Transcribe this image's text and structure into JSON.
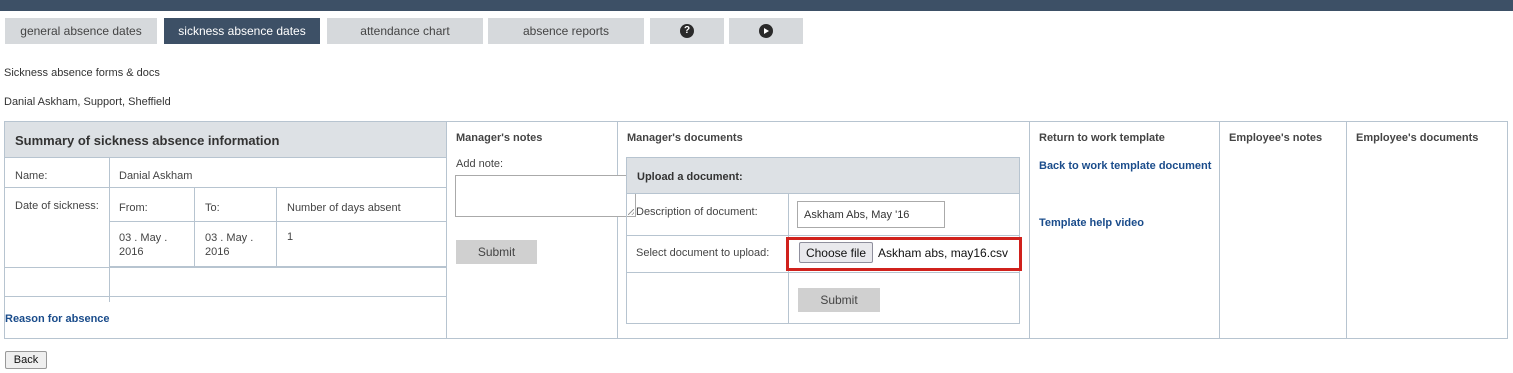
{
  "tabs": [
    {
      "label": "general absence dates",
      "active": false
    },
    {
      "label": "sickness absence dates",
      "active": true
    },
    {
      "label": "attendance chart",
      "active": false
    },
    {
      "label": "absence reports",
      "active": false
    }
  ],
  "tab_icons": [
    "help-icon",
    "play-icon"
  ],
  "subtitle": "Sickness absence forms & docs",
  "employee_line": "Danial Askham, Support, Sheffield",
  "summary": {
    "heading": "Summary of sickness absence information",
    "name_label": "Name:",
    "name_value": "Danial Askham",
    "date_label": "Date of sickness:",
    "from_label": "From:",
    "to_label": "To:",
    "days_label": "Number of days absent",
    "from_value": "03 . May . 2016",
    "to_value": "03 . May . 2016",
    "days_value": "1",
    "reason_link": "Reason for absence"
  },
  "managers_notes": {
    "heading": "Manager's notes",
    "add_note_label": "Add note:",
    "note_value": "",
    "submit_label": "Submit"
  },
  "managers_documents": {
    "heading": "Manager's documents",
    "upload_heading": "Upload a document:",
    "description_label": "Description of document:",
    "description_value": "Askham Abs, May '16",
    "select_label": "Select document to upload:",
    "choose_file_label": "Choose file",
    "file_name": "Askham abs, may16.csv",
    "submit_label": "Submit"
  },
  "return_to_work": {
    "heading": "Return to work template",
    "template_link": "Back to work template document",
    "help_video_link": "Template help video"
  },
  "employee_notes": {
    "heading": "Employee's notes"
  },
  "employee_documents": {
    "heading": "Employee's documents"
  },
  "back_label": "Back",
  "colors": {
    "navy": "#3d5066",
    "link": "#1a4c8b",
    "highlight": "#d0211c"
  }
}
